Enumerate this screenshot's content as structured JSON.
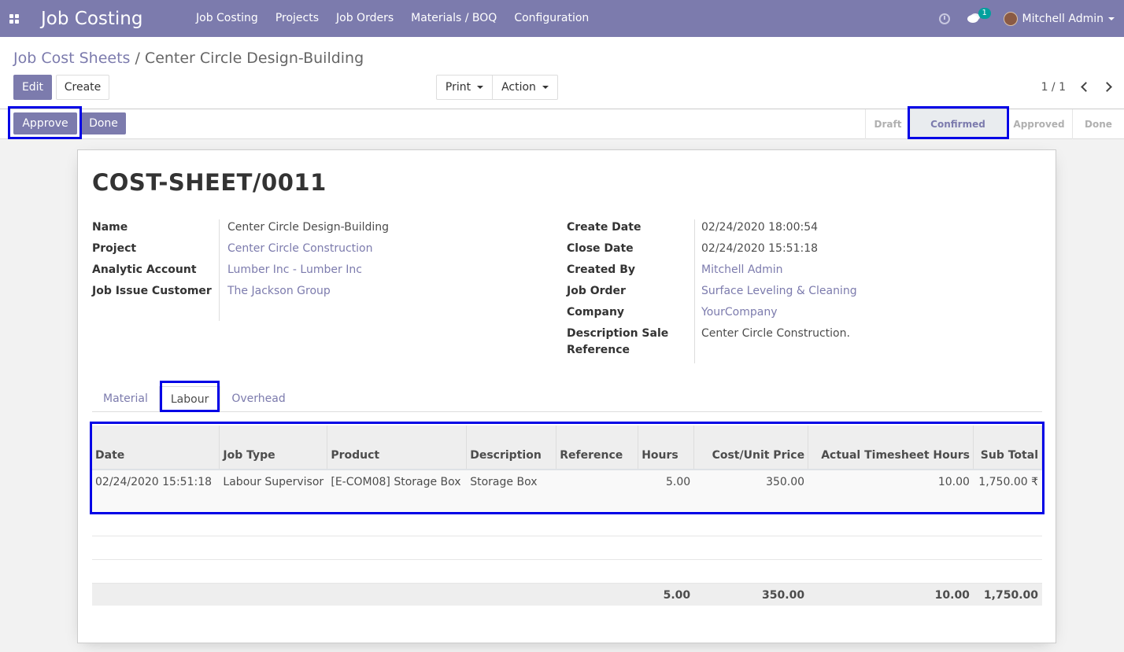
{
  "navbar": {
    "brand": "Job Costing",
    "menu": [
      "Job Costing",
      "Projects",
      "Job Orders",
      "Materials / BOQ",
      "Configuration"
    ],
    "chat_count": "1",
    "user": "Mitchell Admin",
    "color": "#7c7bad"
  },
  "breadcrumb": {
    "parent": "Job Cost Sheets",
    "separator": " / ",
    "current": "Center Circle Design-Building"
  },
  "buttons": {
    "edit": "Edit",
    "create": "Create",
    "print": "Print",
    "action": "Action",
    "approve": "Approve",
    "done": "Done"
  },
  "pager": "1 / 1",
  "stages": [
    "Draft",
    "Confirmed",
    "Approved",
    "Done"
  ],
  "active_stage": "Confirmed",
  "sheet": {
    "title": "COST-SHEET/0011",
    "left_fields": [
      {
        "label": "Name",
        "value": "Center Circle Design-Building"
      },
      {
        "label": "Project",
        "value": "Center Circle Construction"
      },
      {
        "label": "Analytic Account",
        "value": "Lumber Inc - Lumber Inc"
      },
      {
        "label": "Job Issue Customer",
        "value": "The Jackson Group"
      }
    ],
    "right_fields": [
      {
        "label": "Create Date",
        "value": "02/24/2020 18:00:54"
      },
      {
        "label": "Close Date",
        "value": "02/24/2020 15:51:18"
      },
      {
        "label": "Created By",
        "value": "Mitchell Admin"
      },
      {
        "label": "Job Order",
        "value": "Surface Leveling & Cleaning"
      },
      {
        "label": "Company",
        "value": "YourCompany"
      },
      {
        "label": "Description Sale Reference",
        "value": "Center Circle Construction."
      }
    ],
    "tabs": [
      "Material",
      "Labour",
      "Overhead"
    ],
    "active_tab": "Labour",
    "table": {
      "columns": [
        "Date",
        "Job Type",
        "Product",
        "Description",
        "Reference",
        "Hours",
        "Cost/Unit Price",
        "Actual Timesheet Hours",
        "Sub Total"
      ],
      "rows": [
        [
          "02/24/2020 15:51:18",
          "Labour Supervisor",
          "[E-COM08] Storage Box",
          "Storage Box",
          "",
          "5.00",
          "350.00",
          "10.00",
          "1,750.00 ₹"
        ]
      ],
      "totals": {
        "hours": "5.00",
        "cost_unit_price": "350.00",
        "actual_timesheet_hours": "10.00",
        "sub_total": "1,750.00"
      }
    }
  },
  "highlight_color": "#0000e6"
}
